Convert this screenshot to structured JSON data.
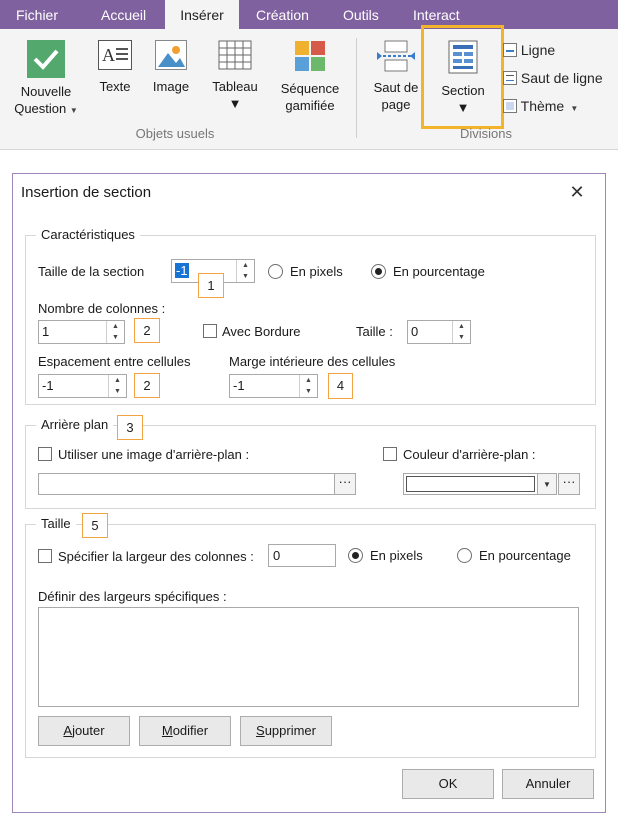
{
  "ribbon": {
    "tabs": [
      {
        "label": "Fichier",
        "active": false
      },
      {
        "label": "Accueil",
        "active": false
      },
      {
        "label": "Insérer",
        "active": true
      },
      {
        "label": "Création",
        "active": false
      },
      {
        "label": "Outils",
        "active": false
      },
      {
        "label": "Interact",
        "active": false
      }
    ],
    "buttons": {
      "nouvelle_question": [
        "Nouvelle",
        "Question"
      ],
      "texte": "Texte",
      "image": "Image",
      "tableau": "Tableau",
      "sequence": [
        "Séquence",
        "gamifiée"
      ],
      "saut_page": [
        "Saut de",
        "page"
      ],
      "section": "Section",
      "ligne": "Ligne",
      "saut_ligne": "Saut de ligne",
      "theme": "Thème"
    },
    "groups": {
      "objets_usuels": "Objets usuels",
      "divisions": "Divisions"
    },
    "colors": {
      "tab_bar": "#8061a0",
      "highlight": "#f3b42b",
      "check_tile": "#52a86d"
    }
  },
  "dialog": {
    "title": "Insertion de section",
    "caracteristiques": {
      "legend": "Caractéristiques",
      "taille_section_label": "Taille de la section",
      "taille_section_value": "-1",
      "badge1": "1",
      "en_pixels": "En pixels",
      "en_pourcentage": "En pourcentage",
      "nb_colonnes_label": "Nombre de colonnes :",
      "nb_colonnes_value": "1",
      "badge2a": "2",
      "avec_bordure": "Avec Bordure",
      "taille_label": "Taille :",
      "taille_value": "0",
      "espacement_label": "Espacement entre cellules",
      "espacement_value": "-1",
      "badge2b": "2",
      "marge_label": "Marge intérieure des cellules",
      "marge_value": "-1",
      "badge4": "4"
    },
    "arriere_plan": {
      "legend": "Arrière plan",
      "badge3": "3",
      "image_label": "Utiliser une image d'arrière-plan :",
      "couleur_label": "Couleur d'arrière-plan :",
      "dots": "···"
    },
    "taille": {
      "legend": "Taille",
      "badge5": "5",
      "specifier_label": "Spécifier la largeur des colonnes :",
      "largeur_value": "0",
      "en_pixels": "En pixels",
      "en_pourcentage": "En pourcentage",
      "definir_label": "Définir des largeurs spécifiques :",
      "ajouter": {
        "first": "A",
        "rest": "jouter"
      },
      "modifier": {
        "first": "M",
        "rest": "odifier"
      },
      "supprimer": {
        "first": "S",
        "rest": "upprimer"
      }
    },
    "ok": "OK",
    "annuler": "Annuler"
  }
}
